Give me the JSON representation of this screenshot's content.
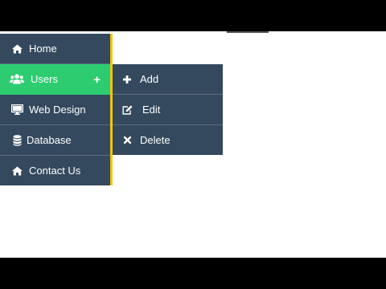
{
  "menu": {
    "items": [
      {
        "label": "Home",
        "icon": "home-icon"
      },
      {
        "label": "Users",
        "icon": "users-icon",
        "expand": "+"
      },
      {
        "label": "Web Design",
        "icon": "monitor-icon"
      },
      {
        "label": "Database",
        "icon": "database-icon"
      },
      {
        "label": "Contact Us",
        "icon": "home-icon"
      }
    ]
  },
  "submenu": {
    "items": [
      {
        "label": "Add",
        "icon": "plus-icon"
      },
      {
        "label": "Edit",
        "icon": "edit-icon"
      },
      {
        "label": "Delete",
        "icon": "times-icon"
      }
    ]
  },
  "colors": {
    "menu_bg": "#34495e",
    "active_bg": "#2ecc71",
    "accent_border": "#f1c40f",
    "text": "#ffffff"
  }
}
